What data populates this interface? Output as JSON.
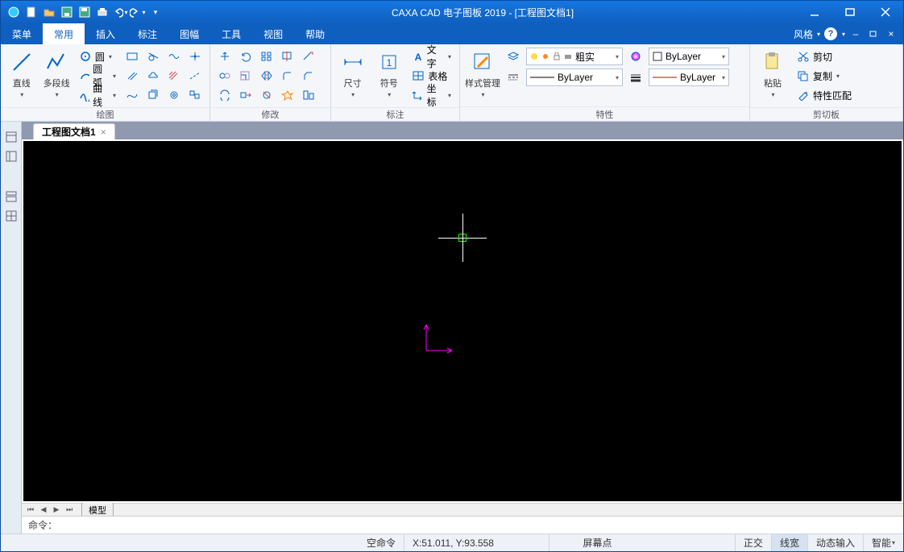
{
  "title": "CAXA CAD 电子图板 2019 - [工程图文档1]",
  "menu": {
    "items": [
      "菜单",
      "常用",
      "插入",
      "标注",
      "图幅",
      "工具",
      "视图",
      "帮助"
    ],
    "active": 1,
    "right": "风格"
  },
  "ribbon": {
    "draw": {
      "label": "绘图",
      "big": [
        {
          "l": "直线"
        },
        {
          "l": "多段线"
        }
      ],
      "mid": [
        {
          "l": "圆"
        },
        {
          "l": "圆弧"
        },
        {
          "l": "曲线"
        }
      ],
      "sm": [
        "rect",
        "cloud",
        "wave",
        "pt",
        "hatch",
        "text",
        "spline",
        "box",
        "region",
        "ellipse",
        "helix",
        "donut"
      ]
    },
    "modify": {
      "label": "修改",
      "sm": [
        "move",
        "rotate",
        "mirror",
        "trim",
        "copy",
        "scale",
        "array",
        "extend",
        "offset",
        "stretch",
        "fillet",
        "chamfer",
        "break",
        "explode",
        "align",
        "join"
      ]
    },
    "annot": {
      "label": "标注",
      "big": [
        {
          "l": "尺寸"
        },
        {
          "l": "符号"
        }
      ],
      "rows": [
        "文字",
        "表格",
        "坐标"
      ]
    },
    "style": {
      "label": "特性",
      "big": "样式管理",
      "layer_state": "粗实",
      "color": "ByLayer",
      "lt": "ByLayer",
      "lw": "ByLayer"
    },
    "clip": {
      "label": "剪切板",
      "big": "粘贴",
      "rows": [
        "剪切",
        "复制",
        "特性匹配"
      ]
    }
  },
  "doc_tab": "工程图文档1",
  "model_tab": "模型",
  "cmd": {
    "prompt": "命令：",
    "empty": "空命令",
    "coord": "X:51.011, Y:93.558",
    "screen": "屏幕点"
  },
  "status": {
    "ortho": "正交",
    "lw": "线宽",
    "dyn": "动态输入",
    "snap": "智能"
  }
}
